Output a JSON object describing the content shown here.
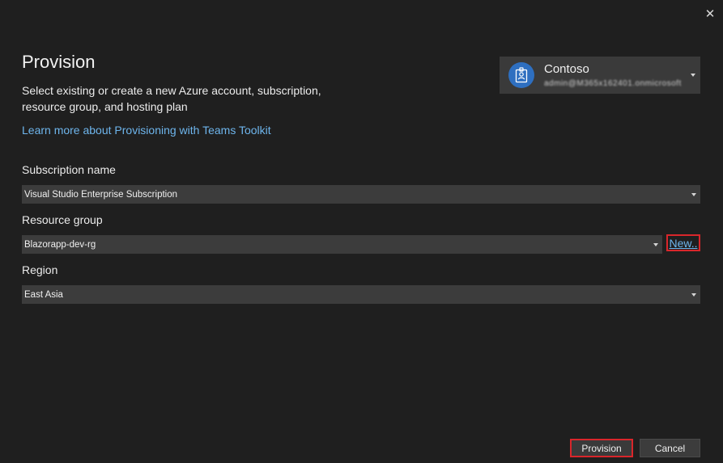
{
  "dialog": {
    "close_glyph": "✕",
    "title": "Provision",
    "description": "Select existing or create a new Azure account, subscription, resource group, and hosting plan",
    "learn_more": "Learn more about Provisioning with Teams Toolkit"
  },
  "account": {
    "name": "Contoso",
    "email": "admin@M365x162401.onmicrosoft.com",
    "icon": "badge-icon"
  },
  "fields": {
    "subscription": {
      "label": "Subscription name",
      "value": "Visual Studio Enterprise Subscription"
    },
    "resource_group": {
      "label": "Resource group",
      "value": "Blazorapp-dev-rg",
      "new_label": "New.."
    },
    "region": {
      "label": "Region",
      "value": "East Asia"
    }
  },
  "buttons": {
    "provision": "Provision",
    "cancel": "Cancel"
  },
  "colors": {
    "background": "#1f1f1f",
    "input_bg": "#3c3c3c",
    "link": "#6eb5ec",
    "highlight": "#d9262b",
    "avatar": "#2e6fc0"
  }
}
